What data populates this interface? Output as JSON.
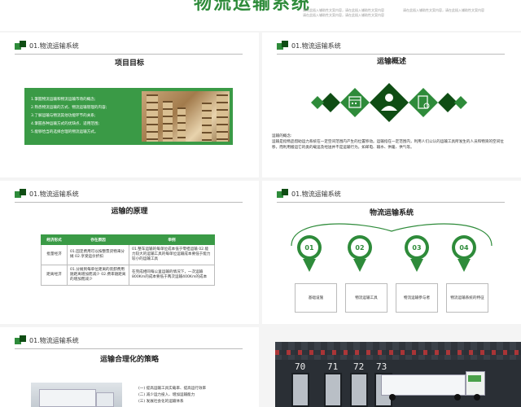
{
  "top": {
    "title": "物流运输系统",
    "desc_lines": [
      "请在此插入辅助性文案内容，请在此插入辅助性文案内容",
      "请在此插入辅助性文案内容，请在此插入辅助性文案内容",
      "请在此插入辅助性文案内容，请在此插入辅助性文案内容"
    ]
  },
  "section_label": "01.物流运输系统",
  "slide1": {
    "title": "项目目标",
    "items": [
      "1.掌握物流运输和物流运输市场的概念;",
      "2.熟悉物流运输的方式、物流运输管理的内容;",
      "3.了解运输与物流其他功能环节的关系;",
      "4.掌握各种运输方式的优缺点、适用范围;",
      "5.能够恰当的选择合理的物流运输方式。"
    ]
  },
  "slide2": {
    "title": "运输概述",
    "text_heading": "运输的概念:",
    "text_body": "运输是指物品借助运力系统在一定空间范围内产生的位置移动。运输指在一定范围内，利用人们公认的运输工具所发生的人员和物资的空间位移，而利用搬运它的类的载运及经送并不是运输行为。如邮电、输水、供暖、供气等。"
  },
  "slide3": {
    "title": "运输的原理",
    "headers": [
      "经济形式",
      "存在原因",
      "举例"
    ],
    "rows": [
      {
        "form": "批量经济",
        "reason": "01.固定费用可以按整票货物来分摊 02.享受运价折扣",
        "example": "01.整车运输的每单位成本低于零担运输 02.能力较大的运输工具的每单位运输成本要低于能力较小的运输工具"
      },
      {
        "form": "距离经济",
        "reason": "01.分摊到每单位距离的装卸费用随距离增加而减少 02.费率随距离的增加而减少",
        "example": "在完成相同每公里运输的情况下，一次运输800Km的成本要低于两次运输400Km的成本"
      }
    ]
  },
  "slide4": {
    "title": "物流运输系统",
    "nodes": [
      {
        "num": "01",
        "label": "基础设施"
      },
      {
        "num": "02",
        "label": "物流运输工具"
      },
      {
        "num": "03",
        "label": "物流运输参与者"
      },
      {
        "num": "04",
        "label": "物流运输系统的特征"
      }
    ]
  },
  "slide5": {
    "title": "运输合理化的策略",
    "items": [
      "(一) 提高运输工具实载率、提高运行效率",
      "(二) 减少运力投入、增加运输能力",
      "(三) 发展社会化的运输体系"
    ]
  },
  "slide6": {
    "dock_numbers": [
      "70",
      "71",
      "72",
      "73"
    ]
  },
  "colors": {
    "accent": "#2e8b3a",
    "dark_green": "#0f4d14",
    "box_green": "#3a9a46"
  }
}
